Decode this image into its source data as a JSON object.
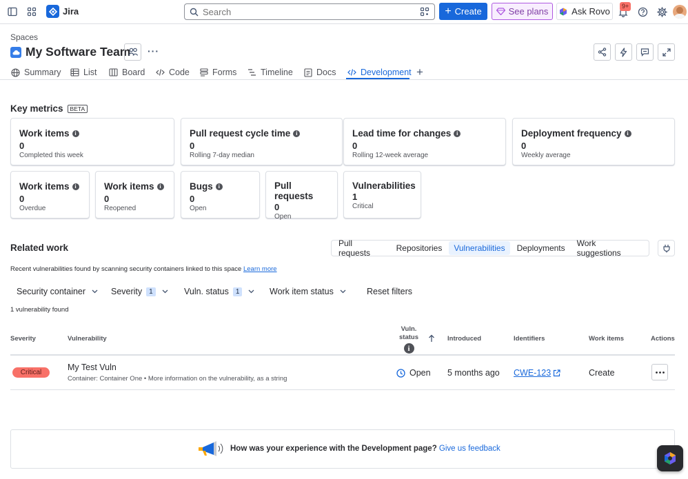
{
  "topnav": {
    "app_name": "Jira",
    "search_placeholder": "Search",
    "create_label": "Create",
    "plans_label": "See plans",
    "rovo_label": "Ask Rovo",
    "notif_count": "9+"
  },
  "header": {
    "breadcrumb": "Spaces",
    "space_title": "My Software Team",
    "more_glyph": "···",
    "tabs": [
      {
        "label": "Summary"
      },
      {
        "label": "List"
      },
      {
        "label": "Board"
      },
      {
        "label": "Code"
      },
      {
        "label": "Forms"
      },
      {
        "label": "Timeline"
      },
      {
        "label": "Docs"
      },
      {
        "label": "Development"
      }
    ],
    "add_tab_glyph": "+"
  },
  "metrics": {
    "title": "Key metrics",
    "badge": "BETA",
    "cards": [
      {
        "title": "Work items",
        "value": "0",
        "sub": "Completed this week"
      },
      {
        "title": "Pull request cycle time",
        "value": "0",
        "sub": "Rolling 7-day median"
      },
      {
        "title": "Lead time for changes",
        "value": "0",
        "sub": "Rolling 12-week average"
      },
      {
        "title": "Deployment frequency",
        "value": "0",
        "sub": "Weekly average"
      },
      {
        "title": "Work items",
        "value": "0",
        "sub": "Overdue"
      },
      {
        "title": "Work items",
        "value": "0",
        "sub": "Reopened"
      },
      {
        "title": "Bugs",
        "value": "0",
        "sub": "Open"
      },
      {
        "title": "Pull requests",
        "value": "0",
        "sub": "Open"
      },
      {
        "title": "Vulnerabilities",
        "value": "1",
        "sub": "Critical"
      }
    ]
  },
  "related": {
    "title": "Related work",
    "tabs": [
      "Pull requests",
      "Repositories",
      "Vulnerabilities",
      "Deployments",
      "Work suggestions"
    ],
    "description": "Recent vulnerabilities found by scanning security containers linked to this space",
    "learn_more": "Learn more",
    "filters": {
      "security_container": "Security container",
      "severity": "Severity",
      "severity_count": "1",
      "vuln_status": "Vuln. status",
      "vuln_status_count": "1",
      "work_item_status": "Work item status",
      "reset": "Reset filters"
    },
    "found_text": "1 vulnerability found",
    "columns": {
      "severity": "Severity",
      "vulnerability": "Vulnerability",
      "vuln_status_1": "Vuln.",
      "vuln_status_2": "status",
      "introduced": "Introduced",
      "identifiers": "Identifiers",
      "work_items": "Work items",
      "actions": "Actions"
    },
    "rows": [
      {
        "severity": "Critical",
        "name": "My Test Vuln",
        "details": "Container: Container One • More information on the vulnerability, as a string",
        "status": "Open",
        "introduced": "5 months ago",
        "identifier": "CWE-123",
        "work_item": "Create"
      }
    ]
  },
  "feedback": {
    "question": "How was your experience with the Development page?",
    "link": "Give us feedback"
  },
  "colors": {
    "primary": "#1868db",
    "critical": "#f87168",
    "border": "#dcdfe4"
  }
}
